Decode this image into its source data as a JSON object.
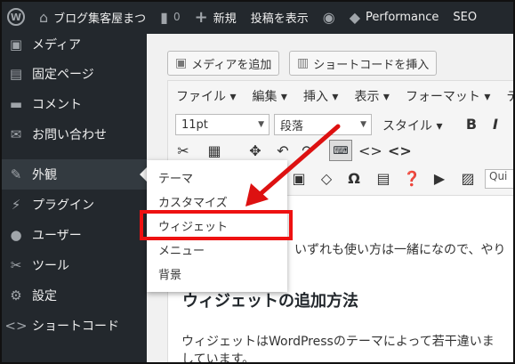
{
  "adminbar": {
    "site_name": "ブログ集客屋まつ",
    "comments_count": "0",
    "new_label": "新規",
    "view_post_label": "投稿を表示",
    "performance_label": "Performance",
    "seo_label": "SEO"
  },
  "sidebar": {
    "items": [
      {
        "label": "メディア",
        "icon": "media-icon"
      },
      {
        "label": "固定ページ",
        "icon": "page-icon"
      },
      {
        "label": "コメント",
        "icon": "comment-icon"
      },
      {
        "label": "お問い合わせ",
        "icon": "mail-icon"
      },
      {
        "label": "外観",
        "icon": "appearance-icon"
      },
      {
        "label": "プラグイン",
        "icon": "plugin-icon"
      },
      {
        "label": "ユーザー",
        "icon": "user-icon"
      },
      {
        "label": "ツール",
        "icon": "tool-icon"
      },
      {
        "label": "設定",
        "icon": "settings-icon"
      },
      {
        "label": "ショートコード",
        "icon": "code-icon"
      }
    ]
  },
  "flyout": {
    "items": [
      "テーマ",
      "カスタマイズ",
      "ウィジェット",
      "メニュー",
      "背景"
    ]
  },
  "editor": {
    "add_media": "メディアを追加",
    "insert_shortcode": "ショートコードを挿入",
    "menubar": [
      "ファイル ▾",
      "編集 ▾",
      "挿入 ▾",
      "表示 ▾",
      "フォーマット ▾",
      "テ"
    ],
    "font_size": "11pt",
    "paragraph": "段落",
    "style": "スタイル ▾",
    "quick_placeholder": "Qui"
  },
  "content": {
    "para1": "いずれも使い方は一緒になので、やり",
    "heading": "ウィジェットの追加方法",
    "para2": "ウィジェットはWordPressのテーマによって若干違いま",
    "para3": "しています。"
  },
  "colors": {
    "adminbar_bg": "#23282d",
    "highlight": "#ee1111",
    "arrow": "#dd1111"
  }
}
